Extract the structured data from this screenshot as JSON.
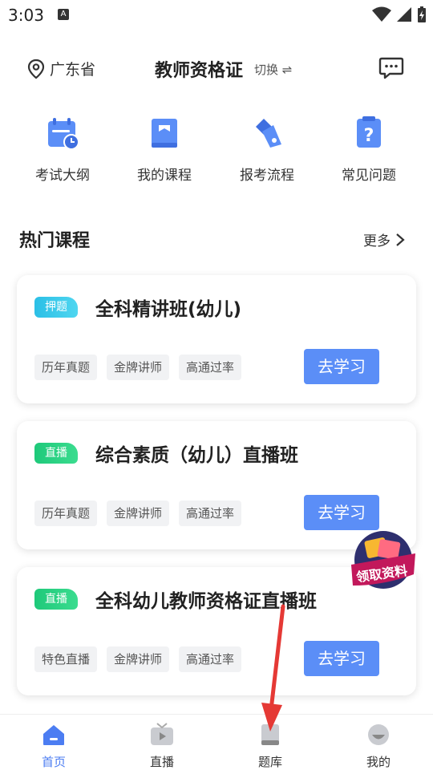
{
  "status": {
    "time": "3:03",
    "notif_letter": "A"
  },
  "header": {
    "location": "广东省",
    "title": "教师资格证",
    "switch_label": "切换 ⇌"
  },
  "quick_nav": [
    {
      "label": "考试大纲",
      "icon": "calendar-icon"
    },
    {
      "label": "我的课程",
      "icon": "book-icon"
    },
    {
      "label": "报考流程",
      "icon": "pen-icon"
    },
    {
      "label": "常见问题",
      "icon": "question-icon"
    }
  ],
  "section": {
    "title": "热门课程",
    "more": "更多"
  },
  "courses": [
    {
      "badge": "押题",
      "title": "全科精讲班(幼儿)",
      "tags": [
        "历年真题",
        "金牌讲师",
        "高通过率"
      ],
      "button": "去学习"
    },
    {
      "badge": "直播",
      "title": "综合素质（幼儿）直播班",
      "tags": [
        "历年真题",
        "金牌讲师",
        "高通过率"
      ],
      "button": "去学习"
    },
    {
      "badge": "直播",
      "title": "全科幼儿教师资格证直播班",
      "tags": [
        "特色直播",
        "金牌讲师",
        "高通过率"
      ],
      "button": "去学习"
    }
  ],
  "promo": {
    "text": "领取资料"
  },
  "bottom_nav": [
    {
      "label": "首页",
      "icon": "home-icon",
      "active": true
    },
    {
      "label": "直播",
      "icon": "tv-icon",
      "active": false
    },
    {
      "label": "题库",
      "icon": "question-bank-icon",
      "active": false
    },
    {
      "label": "我的",
      "icon": "profile-icon",
      "active": false
    }
  ],
  "colors": {
    "accent": "#4c7df2",
    "button": "#5b8ef7",
    "arrow": "#e53935"
  }
}
